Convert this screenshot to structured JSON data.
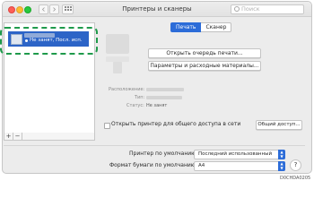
{
  "window": {
    "title": "Принтеры и сканеры",
    "search_placeholder": "Поиск"
  },
  "sidebar": {
    "printers": [
      {
        "status": "Не занят, Посл. исп."
      }
    ],
    "add_label": "+",
    "remove_label": "−"
  },
  "tabs": [
    {
      "label": "Печать",
      "active": true
    },
    {
      "label": "Сканер",
      "active": false
    }
  ],
  "detail": {
    "open_queue_label": "Открыть очередь печати...",
    "options_label": "Параметры и расходные материалы...",
    "info": {
      "location_label": "Расположение:",
      "type_label": "Тип:",
      "status_label": "Статус:",
      "status_value": "Не занят"
    },
    "share_label": "Открыть принтер для общего доступа в сети",
    "share_checked": false,
    "sharing_prefs_label": "Общий доступ..."
  },
  "defaults": {
    "default_printer_label": "Принтер по умолчанию:",
    "default_printer_value": "Последний использованный",
    "paper_size_label": "Формат бумаги по умолчанию:",
    "paper_size_value": "A4",
    "help_label": "?"
  },
  "figure_id": "D0CHDA0205",
  "colors": {
    "selection": "#2c64c7",
    "accent": "#2c6cd8",
    "callout_ring": "#1f9a4b"
  }
}
